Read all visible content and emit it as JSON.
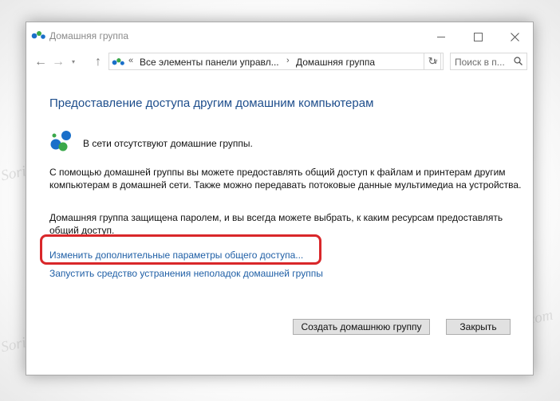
{
  "window": {
    "title": "Домашняя группа"
  },
  "nav": {
    "back": "←",
    "forward": "→",
    "recent": "▾",
    "up": "↑",
    "address_sep1": "«",
    "address_segment1": "Все элементы панели управл...",
    "address_sep2": "›",
    "address_segment2": "Домашняя группа",
    "address_dropdown": "∨",
    "refresh": "↻",
    "search_placeholder": "Поиск в п..."
  },
  "main": {
    "heading": "Предоставление доступа другим домашним компьютерам",
    "status": "В сети отсутствуют домашние группы.",
    "paragraph1": "С помощью домашней группы вы можете предоставлять общий доступ к файлам и принтерам другим компьютерам в домашней сети. Также можно передавать потоковые данные мультимедиа на устройства.",
    "paragraph2": "Домашняя группа защищена паролем, и вы всегда можете выбрать, к каким ресурсам предоставлять общий доступ.",
    "link_advanced": "Изменить дополнительные параметры общего доступа...",
    "link_troubleshoot": "Запустить средство устранения неполадок домашней группы"
  },
  "buttons": {
    "create": "Создать домашнюю группу",
    "close": "Закрыть"
  },
  "watermark": "Soringpcrepair.com",
  "colors": {
    "heading": "#1e4e8c",
    "link": "#1f5fa6",
    "highlight": "#d9272a",
    "homegroup_blue": "#1a6fc9",
    "homegroup_green": "#3aa84a"
  },
  "icons": {
    "app": "homegroup-icon",
    "status": "homegroup-icon",
    "search": "search-icon"
  }
}
